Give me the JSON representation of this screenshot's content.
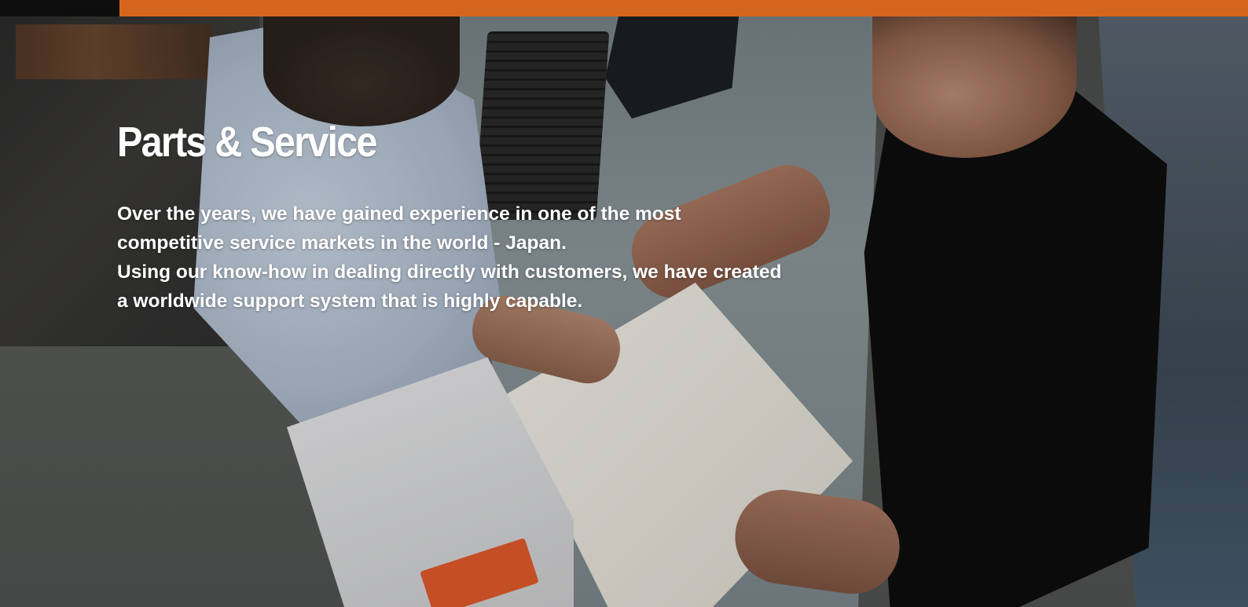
{
  "colors": {
    "accent_bar": "#f47521",
    "text": "#ffffff"
  },
  "hero": {
    "title": "Parts & Service",
    "paragraph_1": "Over the years, we have gained experience in one of the most competitive service markets in the world - Japan.",
    "paragraph_2": "Using our know-how in dealing directly with customers, we have created a worldwide support system that is highly capable.",
    "background_image": "photo of two men reviewing a parts catalog at a desk next to a parts box"
  }
}
